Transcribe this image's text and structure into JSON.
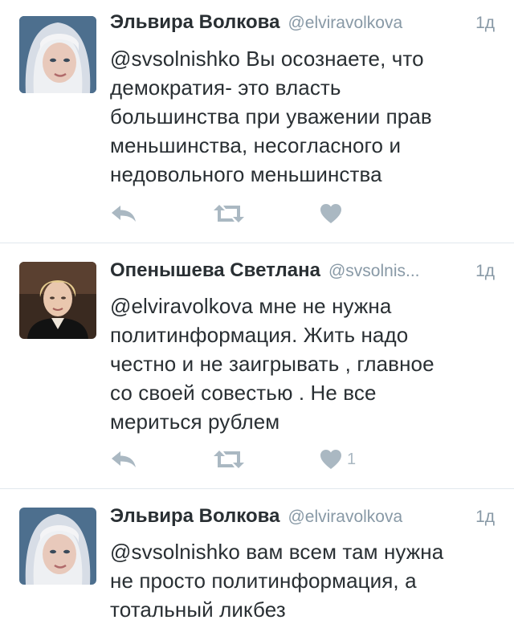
{
  "tweets": [
    {
      "name": "Эльвира Волкова",
      "handle": "@elviravolkova",
      "time": "1д",
      "lines": [
        "@svsolnishko Вы осознаете, что",
        "демократия- это власть",
        "большинства при уважении прав",
        "меньшинства, несогласного и",
        "недовольного меньшинства"
      ],
      "like_count": ""
    },
    {
      "name": "Опенышева Светлана",
      "handle": "@svsolnis...",
      "time": "1д",
      "lines": [
        "@elviravolkova мне не нужна",
        "политинформация. Жить надо",
        "честно и не заигрывать , главное",
        "со своей совестью . Не все",
        "мериться рублем"
      ],
      "like_count": "1"
    },
    {
      "name": "Эльвира Волкова",
      "handle": "@elviravolkova",
      "time": "1д",
      "lines": [
        "@svsolnishko вам всем там нужна",
        "не просто политинформация, а",
        "тотальный ликбез"
      ],
      "like_count": ""
    }
  ],
  "icons": {
    "reply": "reply-icon",
    "retweet": "retweet-icon",
    "like": "heart-icon"
  },
  "colors": {
    "name": "#292f33",
    "secondary": "#8899a6",
    "icon": "#aab8c2",
    "divider": "#e1e8ed"
  }
}
